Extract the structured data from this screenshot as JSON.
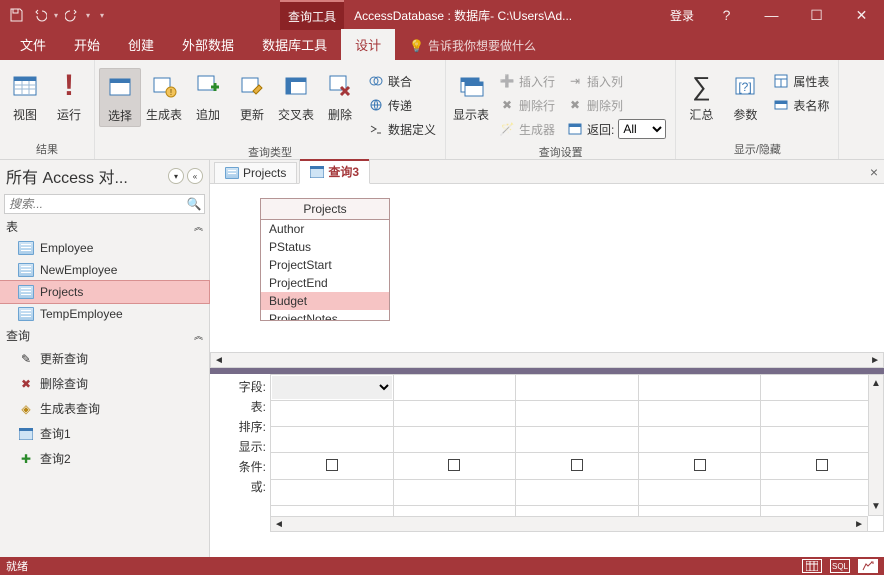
{
  "titlebar": {
    "tool_badge": "查询工具",
    "title": "AccessDatabase : 数据库- C:\\Users\\Ad...",
    "login": "登录"
  },
  "menu": {
    "file": "文件",
    "home": "开始",
    "create": "创建",
    "external": "外部数据",
    "dbtools": "数据库工具",
    "design": "设计",
    "hint": "告诉我你想要做什么"
  },
  "ribbon": {
    "groups": {
      "results": {
        "label": "结果",
        "view": "视图",
        "run": "运行"
      },
      "querytype": {
        "label": "查询类型",
        "select": "选择",
        "make": "生成表",
        "append": "追加",
        "update": "更新",
        "crosstab": "交叉表",
        "delete": "删除",
        "union": "联合",
        "passthrough": "传递",
        "ddl": "数据定义"
      },
      "showtable": "显示表",
      "querysetup": {
        "label": "查询设置",
        "insrow": "插入行",
        "delrow": "删除行",
        "builder": "生成器",
        "inscol": "插入列",
        "delcol": "删除列",
        "return": "返回:",
        "return_value": "All"
      },
      "aggregate": "汇总",
      "params": "参数",
      "showhide": {
        "label": "显示/隐藏",
        "propsheet": "属性表",
        "tablenames": "表名称"
      }
    }
  },
  "navpane": {
    "header": "所有 Access 对...",
    "search_placeholder": "搜索...",
    "section_tables": "表",
    "tables": [
      "Employee",
      "NewEmployee",
      "Projects",
      "TempEmployee"
    ],
    "section_queries": "查询",
    "queries": [
      {
        "label": "更新查询"
      },
      {
        "label": "删除查询"
      },
      {
        "label": "生成表查询"
      },
      {
        "label": "查询1"
      },
      {
        "label": "查询2"
      }
    ]
  },
  "doctabs": {
    "tabs": [
      "Projects",
      "查询3"
    ],
    "active_index": 1
  },
  "design": {
    "fieldlist_title": "Projects",
    "fields": [
      "Author",
      "PStatus",
      "ProjectStart",
      "ProjectEnd",
      "Budget",
      "ProjectNotes"
    ],
    "selected_field": "Budget",
    "grid_rows": [
      "字段:",
      "表:",
      "排序:",
      "显示:",
      "条件:",
      "或:"
    ]
  },
  "statusbar": {
    "left": "就绪",
    "sql": "SQL"
  }
}
